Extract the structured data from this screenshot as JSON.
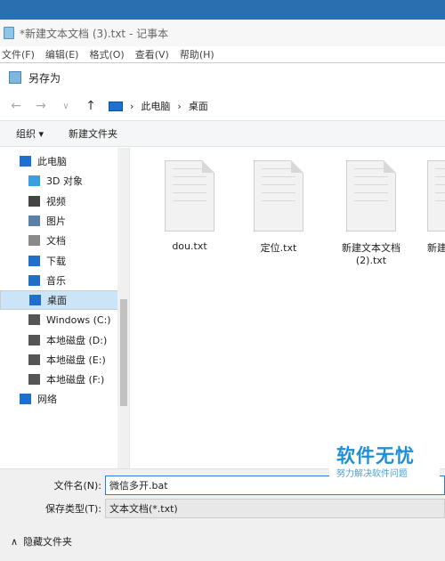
{
  "notepad": {
    "title": "*新建文本文档 (3).txt - 记事本",
    "menu": [
      "文件(F)",
      "编辑(E)",
      "格式(O)",
      "查看(V)",
      "帮助(H)"
    ]
  },
  "dialog": {
    "title": "另存为",
    "breadcrumb": [
      "此电脑",
      "桌面"
    ],
    "toolbar": {
      "organize": "组织 ▾",
      "new_folder": "新建文件夹"
    },
    "tree": [
      {
        "label": "此电脑",
        "icon": "computer-icon",
        "color": "#1e6fd0"
      },
      {
        "label": "3D 对象",
        "icon": "cube-icon",
        "color": "#3aa0e0"
      },
      {
        "label": "视频",
        "icon": "video-icon",
        "color": "#444444"
      },
      {
        "label": "图片",
        "icon": "picture-icon",
        "color": "#5a7fa8"
      },
      {
        "label": "文档",
        "icon": "document-icon",
        "color": "#8a8a8a"
      },
      {
        "label": "下载",
        "icon": "download-icon",
        "color": "#1f6fc8"
      },
      {
        "label": "音乐",
        "icon": "music-icon",
        "color": "#1f6fc8"
      },
      {
        "label": "桌面",
        "icon": "desktop-icon",
        "color": "#1e6fd0"
      },
      {
        "label": "Windows (C:)",
        "icon": "drive-icon",
        "color": "#555555"
      },
      {
        "label": "本地磁盘 (D:)",
        "icon": "drive-icon",
        "color": "#555555"
      },
      {
        "label": "本地磁盘 (E:)",
        "icon": "drive-icon",
        "color": "#555555"
      },
      {
        "label": "本地磁盘 (F:)",
        "icon": "drive-icon",
        "color": "#555555"
      },
      {
        "label": "网络",
        "icon": "network-icon",
        "color": "#1e6fd0"
      }
    ],
    "files": [
      {
        "name": "dou.txt"
      },
      {
        "name": "定位.txt"
      },
      {
        "name": "新建文本文档\n(2).txt"
      },
      {
        "name": "新建"
      }
    ],
    "filename_label": "文件名(N):",
    "filename_value": "微信多开.bat",
    "filetype_label": "保存类型(T):",
    "filetype_value": "文本文档(*.txt)",
    "hide_folders": "隐藏文件夹"
  },
  "watermark": {
    "main": "软件无忧",
    "sub": "努力解决软件问题"
  }
}
